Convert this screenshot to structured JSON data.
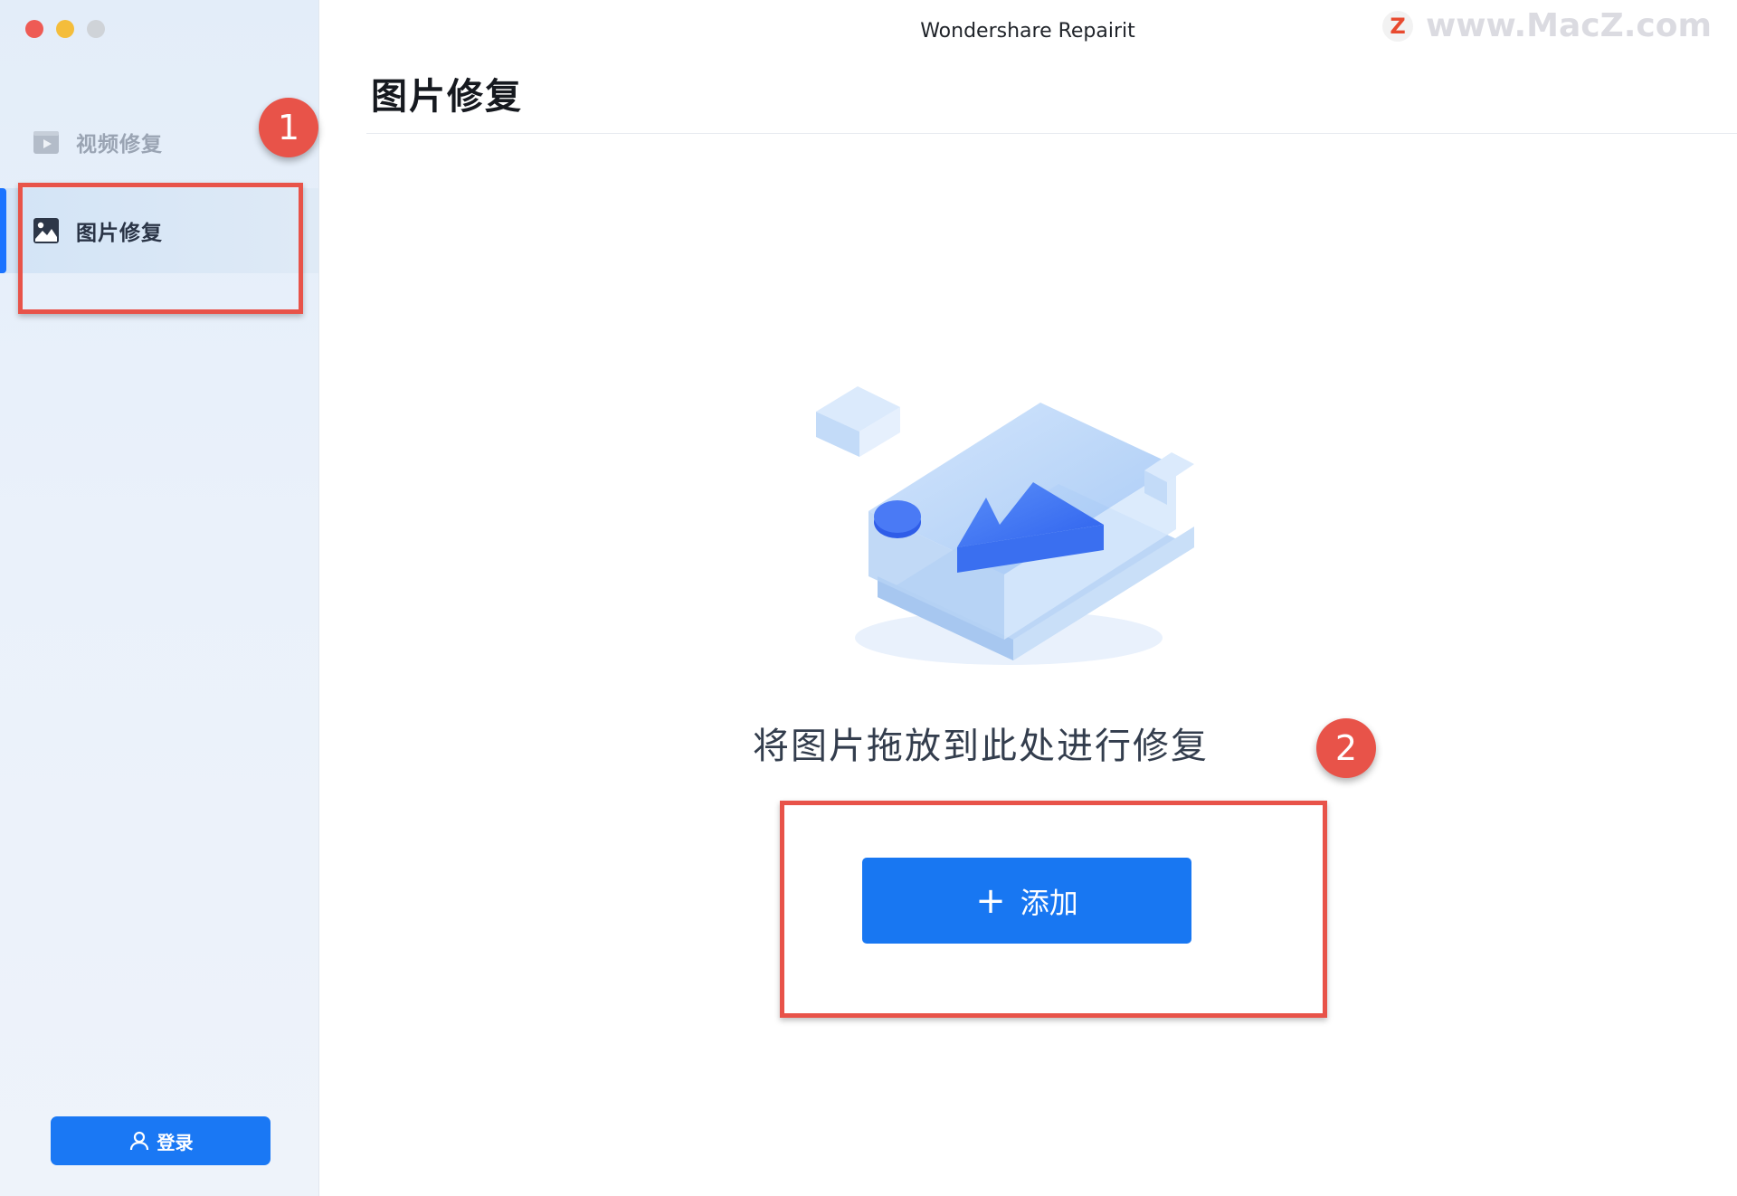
{
  "window": {
    "title": "Wondershare Repairit"
  },
  "watermark": {
    "logo": "Z",
    "text": "www.MacZ.com"
  },
  "sidebar": {
    "items": [
      {
        "label": "视频修复",
        "icon": "video-play-icon",
        "active": false
      },
      {
        "label": "图片修复",
        "icon": "image-icon",
        "active": true
      }
    ],
    "login_label": "登录"
  },
  "main": {
    "page_title": "图片修复",
    "drop_hint": "将图片拖放到此处进行修复",
    "add_button_label": "添加",
    "add_button_icon": "+"
  },
  "annotations": {
    "step1": "1",
    "step2": "2"
  },
  "colors": {
    "accent": "#1877f2",
    "annotation": "#e85349",
    "sidebar_bg": "#e6eef9"
  }
}
